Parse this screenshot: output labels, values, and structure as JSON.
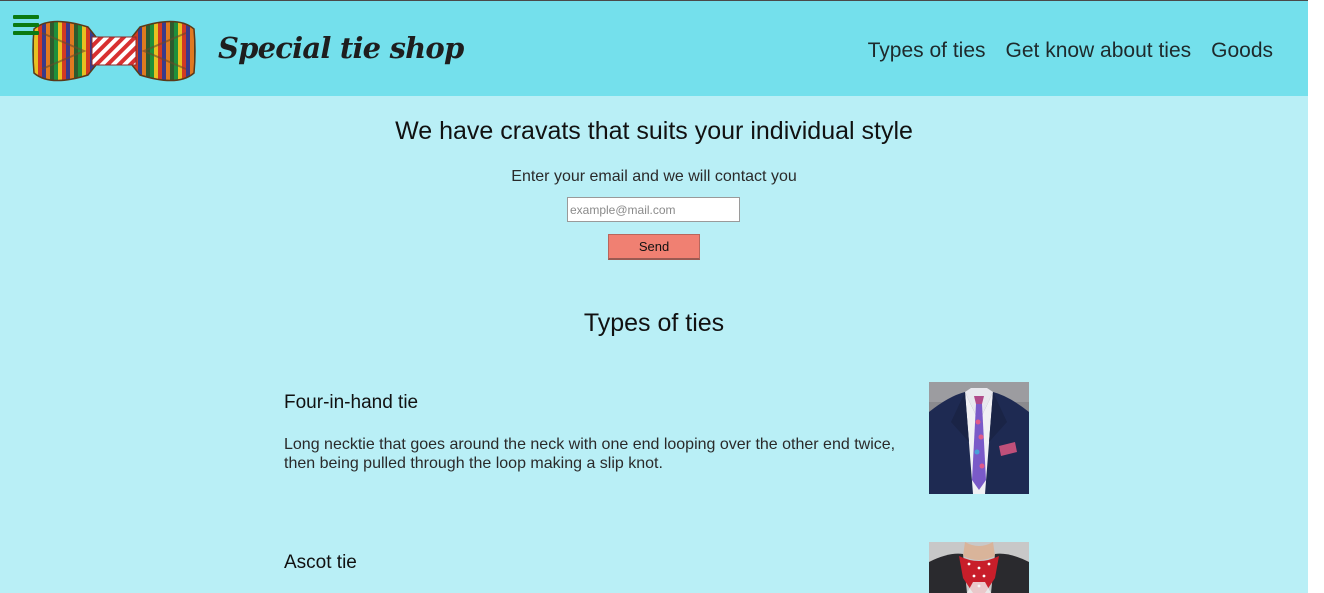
{
  "header": {
    "brand": "Special tie shop",
    "logo_icon": "bow-tie-logo",
    "menu_icon": "hamburger-menu-icon",
    "nav": [
      {
        "label": "Types of ties"
      },
      {
        "label": "Get know about ties"
      },
      {
        "label": "Goods"
      }
    ],
    "colors": {
      "header_bg": "#74e0ec",
      "page_bg": "#b9eff6",
      "menu_icon": "#0a7a12"
    }
  },
  "hero": {
    "title": "We have cravats that suits your individual style",
    "subtitle": "Enter your email and we will contact you",
    "email_placeholder": "example@mail.com",
    "email_value": "",
    "send_label": "Send",
    "send_color": "#f08072"
  },
  "types_section": {
    "title": "Types of ties",
    "items": [
      {
        "name": "Four-in-hand tie",
        "description": "Long necktie that goes around the neck with one end looping over the other end twice, then being pulled through the loop making a slip knot.",
        "image_icon": "four-in-hand-tie-photo"
      },
      {
        "name": "Ascot tie",
        "description": "",
        "image_icon": "ascot-tie-photo"
      }
    ]
  }
}
